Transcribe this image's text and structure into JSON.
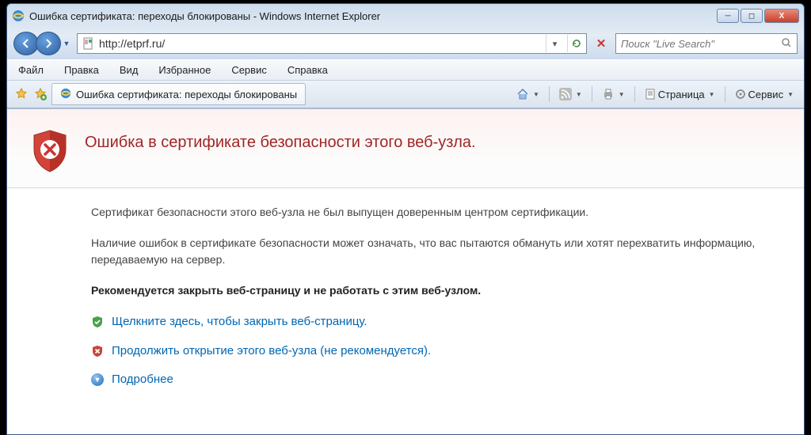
{
  "window": {
    "title": "Ошибка сертификата: переходы блокированы - Windows Internet Explorer"
  },
  "address": {
    "url": "http://etprf.ru/"
  },
  "search": {
    "placeholder": "Поиск \"Live Search\""
  },
  "menubar": {
    "file": "Файл",
    "edit": "Правка",
    "view": "Вид",
    "favorites": "Избранное",
    "tools": "Сервис",
    "help": "Справка"
  },
  "tab": {
    "title": "Ошибка сертификата: переходы блокированы"
  },
  "toolbar": {
    "page": "Страница",
    "service": "Сервис"
  },
  "cert": {
    "heading": "Ошибка в сертификате безопасности этого веб-узла.",
    "para1": "Сертификат безопасности этого веб-узла не был выпущен доверенным центром сертификации.",
    "para2": "Наличие ошибок в сертификате безопасности может означать, что вас пытаются обмануть или хотят перехватить информацию, передаваемую на сервер.",
    "recommend": "Рекомендуется закрыть веб-страницу и не работать с этим веб-узлом.",
    "close_link": "Щелкните здесь, чтобы закрыть веб-страницу.",
    "continue_link": "Продолжить открытие этого веб-узла (не рекомендуется).",
    "more": "Подробнее"
  }
}
